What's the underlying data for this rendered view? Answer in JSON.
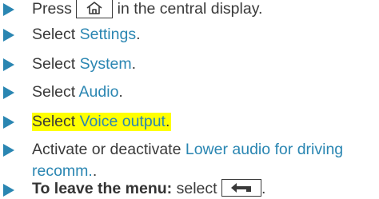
{
  "steps": [
    {
      "pre": "Press ",
      "icon": "home-icon",
      "post": " in the central display."
    },
    {
      "pre": "Select ",
      "link": "Settings",
      "post": "."
    },
    {
      "pre": "Select ",
      "link": "System",
      "post": "."
    },
    {
      "pre": "Select ",
      "link": "Audio",
      "post": "."
    },
    {
      "pre": "Select ",
      "link": "Voice output",
      "post": ".",
      "highlighted": true
    },
    {
      "pre": "Activate or deactivate ",
      "link_line1": "Lower audio for driving",
      "link_line2": "recomm.",
      "post": "."
    },
    {
      "bold": "To leave the menu:",
      "pre": " select ",
      "icon": "back-icon",
      "post": "."
    }
  ],
  "colors": {
    "accent": "#2a86b2",
    "highlight": "#ffff00",
    "text": "#3a3a3a"
  }
}
